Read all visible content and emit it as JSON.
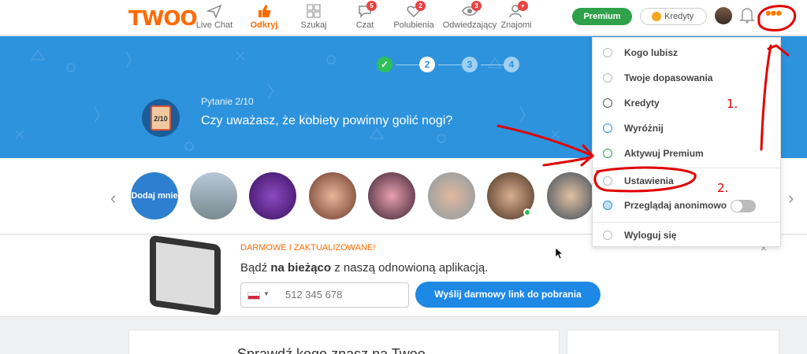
{
  "brand": {
    "logo": "TWOO",
    "accent": "#ff6a00",
    "hero_color": "#2e93dd"
  },
  "nav": {
    "items": [
      {
        "label": "Live Chat",
        "icon": "paper-plane-icon"
      },
      {
        "label": "Odkryj",
        "icon": "thumbs-up-icon",
        "active": true
      },
      {
        "label": "Szukaj",
        "icon": "grid-icon"
      },
      {
        "label": "Czat",
        "icon": "chat-bubble-icon",
        "badge": "5"
      },
      {
        "label": "Polubienia",
        "icon": "heart-icon",
        "badge": "2"
      },
      {
        "label": "Odwiedzający",
        "icon": "eye-icon",
        "badge": "3"
      },
      {
        "label": "Znajomi",
        "icon": "person-add-icon",
        "badge": "+"
      }
    ],
    "premium_label": "Premium",
    "credits_label": "Kredyty",
    "more_label": "•••"
  },
  "hero": {
    "steps": [
      "2",
      "3",
      "4"
    ],
    "question_icon_text": "2/10",
    "question_label": "Pytanie 2/10",
    "question_text": "Czy uważasz, że kobiety powinny golić nogi?"
  },
  "carousel": {
    "add_label": "Dodaj mnie",
    "prev_icon": "chevron-left-icon",
    "next_icon": "chevron-right-icon"
  },
  "promo": {
    "heading": "DARMOWE I ZAKTUALIZOWANE!",
    "text_prefix": "Bądź ",
    "text_bold": "na bieżąco",
    "text_suffix": " z naszą odnowioną aplikacją.",
    "phone_placeholder": "512 345 678",
    "send_label": "Wyślij darmowy link do pobrania",
    "close_label": "×"
  },
  "card": {
    "title": "Sprawdź kogo znasz na Twoo"
  },
  "menu": {
    "items": [
      {
        "label": "Kogo lubisz",
        "icon": "check-circle-icon"
      },
      {
        "label": "Twoje dopasowania",
        "icon": "heart-outline-icon"
      },
      {
        "label": "Kredyty",
        "icon": "coin-icon"
      },
      {
        "label": "Wyróżnij",
        "icon": "boost-icon"
      },
      {
        "label": "Aktywuj Premium",
        "icon": "premium-icon"
      },
      {
        "label": "Ustawienia",
        "icon": "gear-icon"
      },
      {
        "label": "Przeglądaj anonimowo",
        "icon": "ghost-icon"
      },
      {
        "label": "Wyloguj się",
        "icon": "power-icon"
      }
    ]
  },
  "annotations": {
    "mark1": "1.",
    "mark2": "2."
  }
}
